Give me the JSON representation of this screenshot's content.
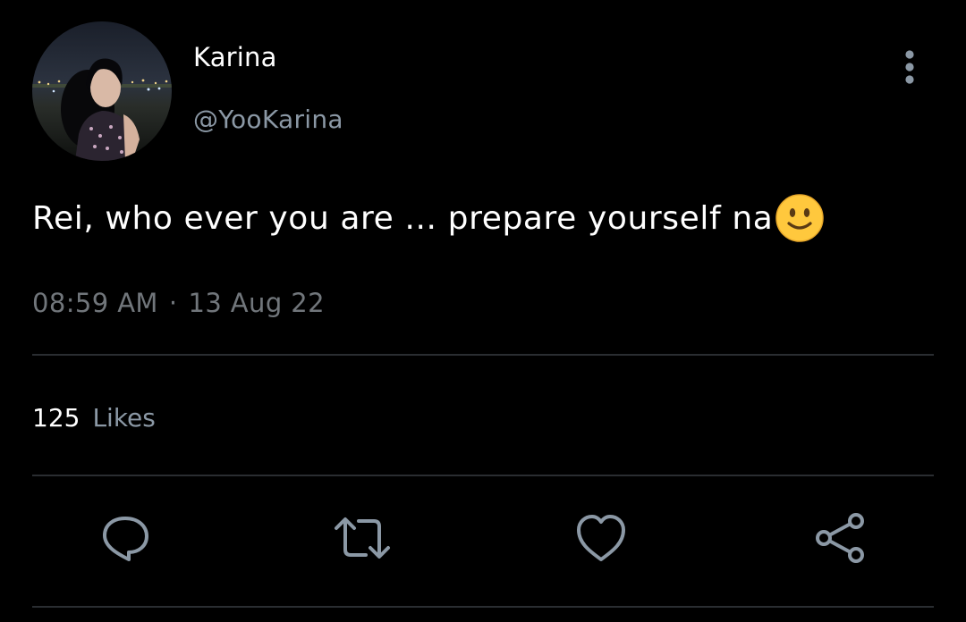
{
  "author": {
    "display_name": "Karina",
    "handle": "@YooKarina"
  },
  "tweet": {
    "text": "Rei, who ever you are ... prepare yourself na",
    "emoji": "slightly-smiling-face-icon",
    "time": "08:59 AM",
    "separator": "·",
    "date": "13 Aug 22"
  },
  "stats": {
    "likes_count": "125",
    "likes_label": "Likes"
  },
  "actions": [
    "reply-icon",
    "retweet-icon",
    "like-icon",
    "share-icon"
  ],
  "colors": {
    "background": "#000000",
    "primary_text": "#ffffff",
    "secondary_text": "#71767b",
    "divider": "#2a2d31",
    "icon": "#8b98a5",
    "emoji_face": "#ffc83d"
  }
}
